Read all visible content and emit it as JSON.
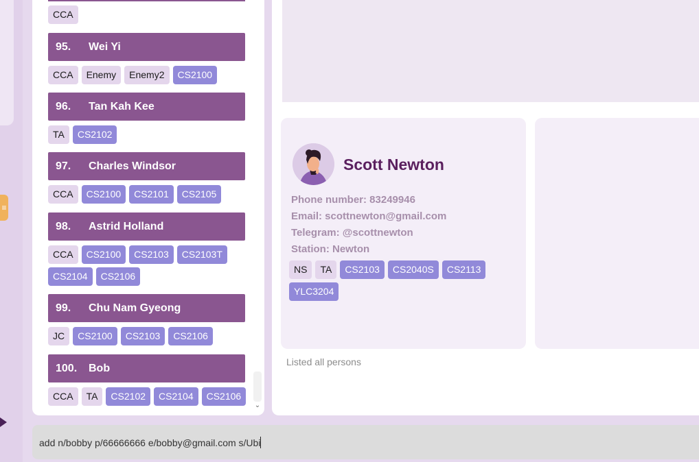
{
  "sidebar": {
    "toggle_label": "≡",
    "arrow_label": "▶"
  },
  "person_list": {
    "top_partial": {
      "tags": [
        {
          "label": "CCA",
          "kind": "role"
        }
      ]
    },
    "persons": [
      {
        "index": "95.",
        "name": "Wei Yi",
        "tags": [
          {
            "label": "CCA",
            "kind": "role"
          },
          {
            "label": "Enemy",
            "kind": "role"
          },
          {
            "label": "Enemy2",
            "kind": "role"
          },
          {
            "label": "CS2100",
            "kind": "course"
          }
        ]
      },
      {
        "index": "96.",
        "name": "Tan Kah Kee",
        "tags": [
          {
            "label": "TA",
            "kind": "role"
          },
          {
            "label": "CS2102",
            "kind": "course"
          }
        ]
      },
      {
        "index": "97.",
        "name": "Charles Windsor",
        "tags": [
          {
            "label": "CCA",
            "kind": "role"
          },
          {
            "label": "CS2100",
            "kind": "course"
          },
          {
            "label": "CS2101",
            "kind": "course"
          },
          {
            "label": "CS2105",
            "kind": "course"
          }
        ]
      },
      {
        "index": "98.",
        "name": "Astrid Holland",
        "tags": [
          {
            "label": "CCA",
            "kind": "role"
          },
          {
            "label": "CS2100",
            "kind": "course"
          },
          {
            "label": "CS2103",
            "kind": "course"
          },
          {
            "label": "CS2103T",
            "kind": "course"
          },
          {
            "label": "CS2104",
            "kind": "course"
          },
          {
            "label": "CS2106",
            "kind": "course"
          }
        ]
      },
      {
        "index": "99.",
        "name": "Chu Nam Gyeong",
        "tags": [
          {
            "label": "JC",
            "kind": "role"
          },
          {
            "label": "CS2100",
            "kind": "course"
          },
          {
            "label": "CS2103",
            "kind": "course"
          },
          {
            "label": "CS2106",
            "kind": "course"
          }
        ]
      },
      {
        "index": "100.",
        "name": "Bob",
        "tags": [
          {
            "label": "CCA",
            "kind": "role"
          },
          {
            "label": "TA",
            "kind": "role"
          },
          {
            "label": "CS2102",
            "kind": "course"
          },
          {
            "label": "CS2104",
            "kind": "course"
          },
          {
            "label": "CS2106",
            "kind": "course"
          }
        ]
      }
    ],
    "scroll_down_label": "⌄"
  },
  "detail_card": {
    "name": "Scott Newton",
    "phone": "Phone number: 83249946",
    "email": "Email: scottnewton@gmail.com",
    "telegram": "Telegram: @scottnewton",
    "station": "Station: Newton",
    "tags": [
      {
        "label": "NS",
        "kind": "role"
      },
      {
        "label": "TA",
        "kind": "role"
      },
      {
        "label": "CS2103",
        "kind": "course"
      },
      {
        "label": "CS2040S",
        "kind": "course"
      },
      {
        "label": "CS2113",
        "kind": "course"
      },
      {
        "label": "YLC3204",
        "kind": "course"
      }
    ]
  },
  "status": {
    "message": "Listed all persons"
  },
  "command": {
    "value": "add n/bobby p/66666666 e/bobby@gmail.com s/Ubi"
  },
  "colors": {
    "header_purple": "#8a5690",
    "role_tag": "#e4d6ec",
    "course_tag": "#9189d9",
    "name_text": "#5a1f5e"
  }
}
